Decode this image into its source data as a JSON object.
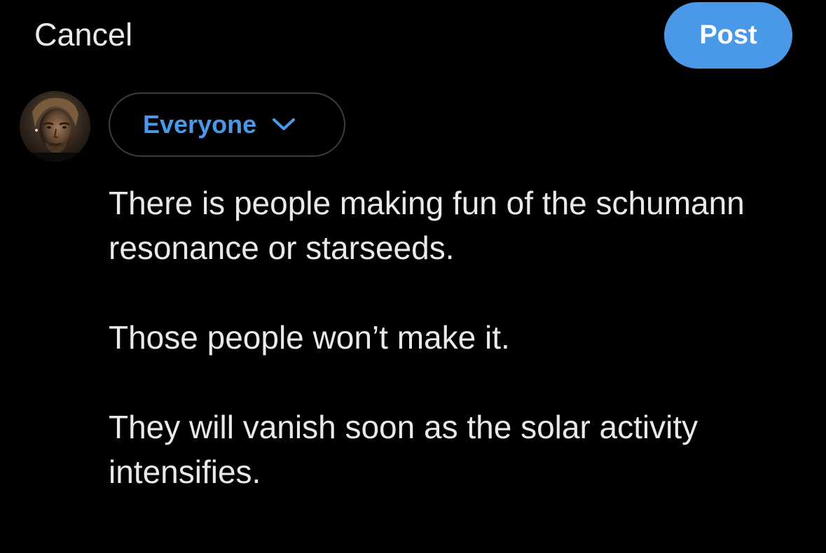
{
  "header": {
    "cancel_label": "Cancel",
    "post_label": "Post"
  },
  "composer": {
    "avatar_icon": "user-avatar-photo",
    "audience_label": "Everyone",
    "audience_icon": "chevron-down-icon",
    "accent_color": "#4a99e9",
    "paragraphs": [
      "There is people making fun of the schumann resonance or starseeds.",
      "Those people won’t make it.",
      "They will vanish soon as the solar activity intensifies."
    ]
  }
}
